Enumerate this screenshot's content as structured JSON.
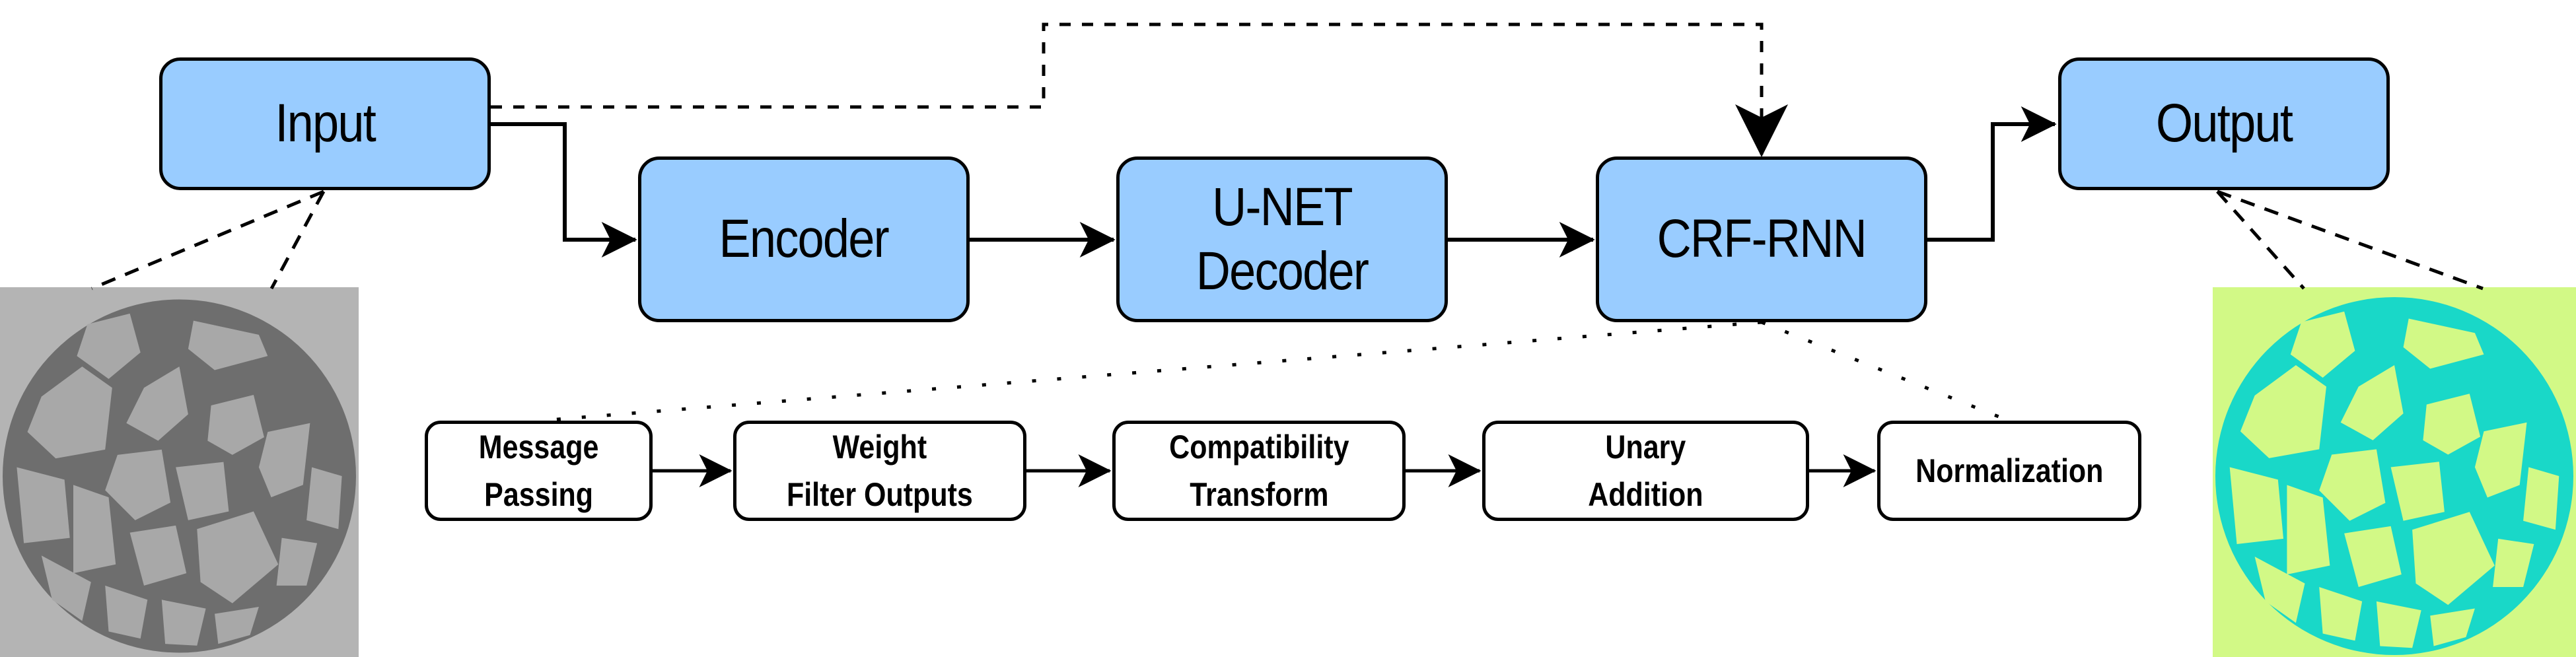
{
  "diagram": {
    "type": "pipeline",
    "main_nodes": [
      {
        "id": "input",
        "label": "Input"
      },
      {
        "id": "encoder",
        "label": "Encoder"
      },
      {
        "id": "unet-decoder",
        "label": "U-NET\nDecoder"
      },
      {
        "id": "crf-rnn",
        "label": "CRF-RNN"
      },
      {
        "id": "output",
        "label": "Output"
      }
    ],
    "crf_rnn_steps": [
      {
        "id": "message-passing",
        "label": "Message\nPassing"
      },
      {
        "id": "weight-filter-outputs",
        "label": "Weight\nFilter Outputs"
      },
      {
        "id": "compatibility-transform",
        "label": "Compatibility\nTransform"
      },
      {
        "id": "unary-addition",
        "label": "Unary\nAddition"
      },
      {
        "id": "normalization",
        "label": "Normalization"
      }
    ],
    "edges": [
      {
        "from": "input",
        "to": "encoder",
        "style": "solid"
      },
      {
        "from": "encoder",
        "to": "unet-decoder",
        "style": "solid"
      },
      {
        "from": "unet-decoder",
        "to": "crf-rnn",
        "style": "solid"
      },
      {
        "from": "crf-rnn",
        "to": "output",
        "style": "solid"
      },
      {
        "from": "input",
        "to": "crf-rnn",
        "style": "dashed"
      },
      {
        "from": "message-passing",
        "to": "weight-filter-outputs",
        "style": "solid"
      },
      {
        "from": "weight-filter-outputs",
        "to": "compatibility-transform",
        "style": "solid"
      },
      {
        "from": "compatibility-transform",
        "to": "unary-addition",
        "style": "solid"
      },
      {
        "from": "unary-addition",
        "to": "normalization",
        "style": "solid"
      }
    ],
    "images": {
      "input": {
        "description": "grayscale CT cross-section of granular sample"
      },
      "output": {
        "description": "two-class segmentation map of the CT cross-section"
      }
    },
    "colors": {
      "node_fill": "#99ccff",
      "sub_node_fill": "#ffffff",
      "stroke": "#000000",
      "seg_background": "#d2f986",
      "seg_foreground": "#19d8c8",
      "ct_background": "#b4b4b4",
      "ct_matrix": "#6e6e6e",
      "ct_grain": "#a8a8a8"
    }
  }
}
